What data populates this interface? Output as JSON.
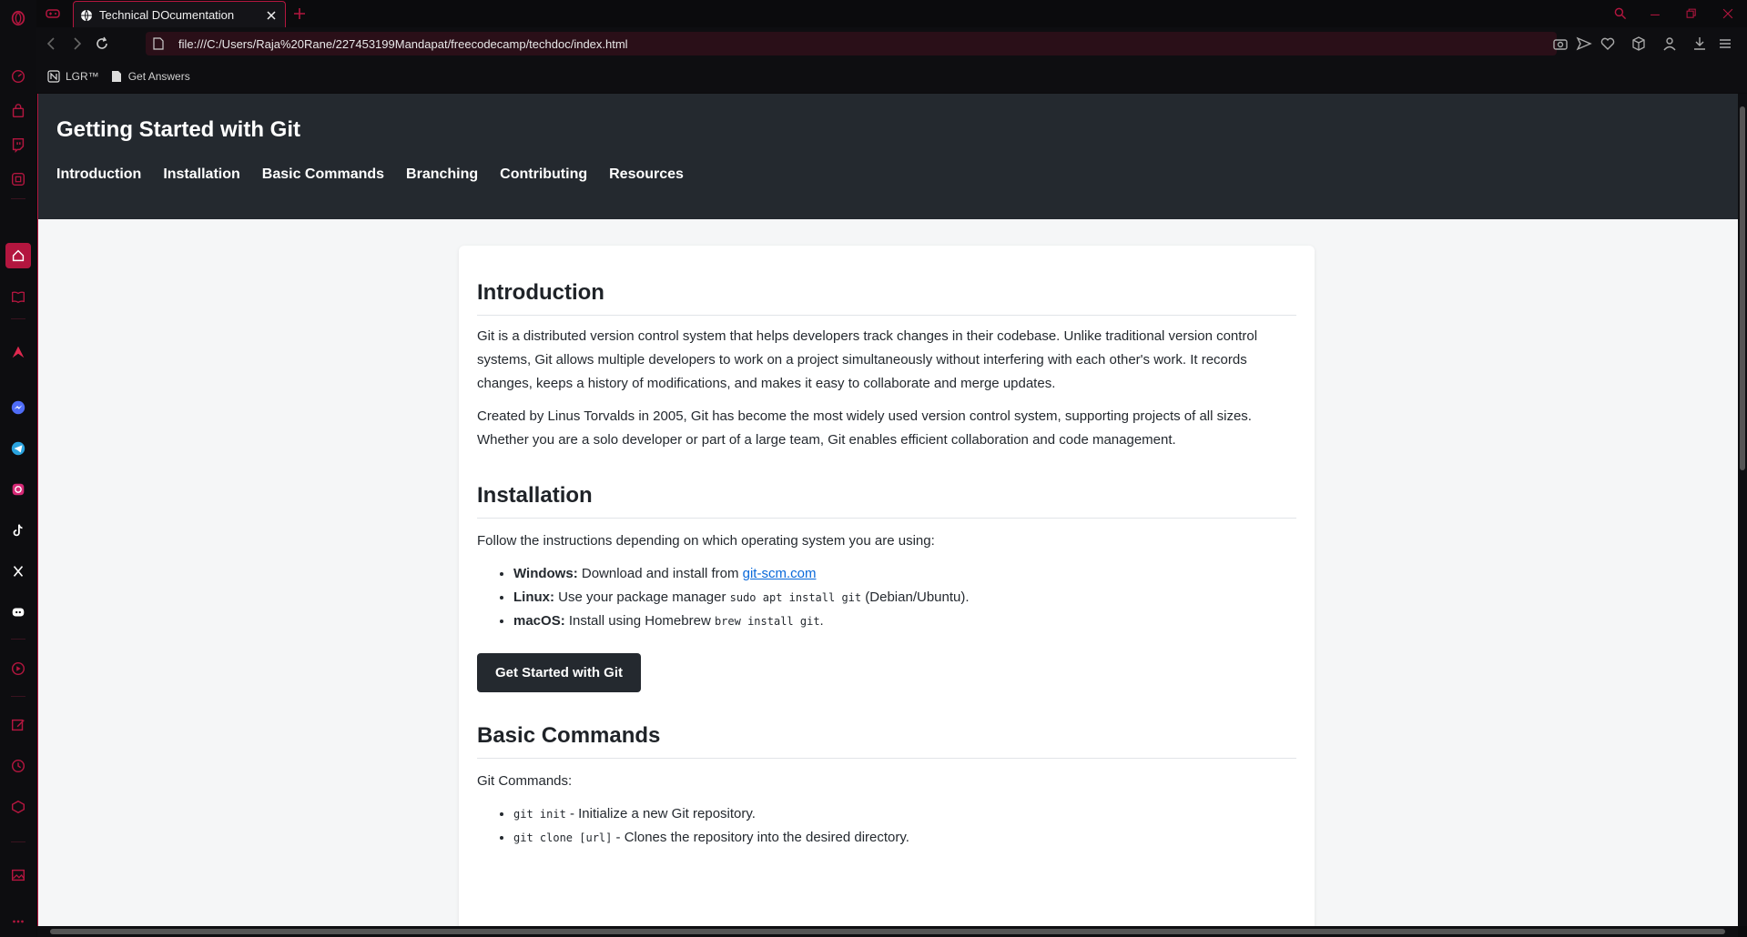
{
  "browser": {
    "tab_title": "Technical DOcumentation",
    "url": "file:///C:/Users/Raja%20Rane/227453199Mandapat/freecodecamp/techdoc/index.html",
    "bookmarks": [
      "LGR™",
      "Get Answers"
    ],
    "accent_color": "#b3163f",
    "sidebar_icons": [
      "speed-dial-icon",
      "shopping-bag-icon",
      "twitch-icon",
      "gx-corner-icon",
      "home-icon",
      "bookmarks-icon",
      "aria-icon",
      "messenger-icon",
      "telegram-icon",
      "instagram-icon",
      "tiktok-icon",
      "x-icon",
      "discord-icon",
      "player-icon",
      "pinboard-icon",
      "history-icon",
      "extensions-icon",
      "gallery-icon",
      "more-icon"
    ]
  },
  "page": {
    "header_title": "Getting Started with Git",
    "nav": [
      "Introduction",
      "Installation",
      "Basic Commands",
      "Branching",
      "Contributing",
      "Resources"
    ],
    "intro": {
      "heading": "Introduction",
      "p1": "Git is a distributed version control system that helps developers track changes in their codebase. Unlike traditional version control systems, Git allows multiple developers to work on a project simultaneously without interfering with each other's work. It records changes, keeps a history of modifications, and makes it easy to collaborate and merge updates.",
      "p2": "Created by Linus Torvalds in 2005, Git has become the most widely used version control system, supporting projects of all sizes. Whether you are a solo developer or part of a large team, Git enables efficient collaboration and code management."
    },
    "installation": {
      "heading": "Installation",
      "lead": "Follow the instructions depending on which operating system you are using:",
      "windows_label": "Windows:",
      "windows_text": "Download and install from",
      "windows_link": "git-scm.com",
      "linux_label": "Linux:",
      "linux_text": "Use your package manager",
      "linux_code": "sudo apt install git",
      "linux_suffix": "(Debian/Ubuntu).",
      "mac_label": "macOS:",
      "mac_text": "Install using Homebrew",
      "mac_code": "brew install git",
      "mac_suffix": ".",
      "button": "Get Started with Git"
    },
    "basic_commands": {
      "heading": "Basic Commands",
      "lead": "Git Commands:",
      "items": [
        {
          "code": "git init",
          "desc": "- Initialize a new Git repository."
        },
        {
          "code": "git clone [url]",
          "desc": "- Clones the repository into the desired directory."
        }
      ]
    }
  }
}
